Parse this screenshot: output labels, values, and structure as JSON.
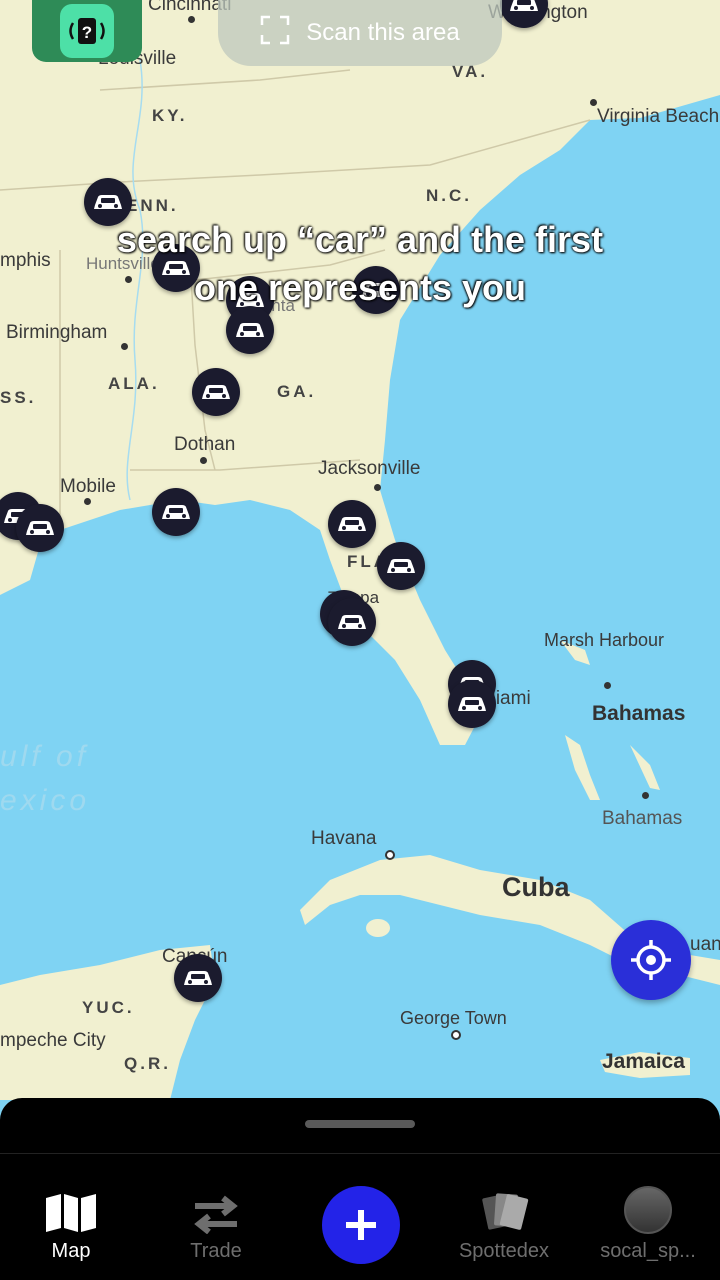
{
  "top": {
    "scan_label": "Scan this area",
    "badge_icon": "mystery-card-icon"
  },
  "caption": {
    "line1": "search up “car” and the first",
    "line2": "one represents you"
  },
  "map": {
    "cities": {
      "cincinnati": "Cincinnati",
      "louisville": "Louisville",
      "washington": "Washington",
      "virginia_beach": "Virginia Beach",
      "memphis": "mphis",
      "huntsville": "Huntsville",
      "birmingham": "Birmingham",
      "atlanta": "Atlanta",
      "dothan": "Dothan",
      "jacksonville": "Jacksonville",
      "mobile": "Mobile",
      "tampa": "Tampa",
      "miami": "Miami",
      "marsh_harbour": "Marsh Harbour",
      "havana": "Havana",
      "cancun": "Cancún",
      "george_town": "George Town",
      "campeche": "mpeche City",
      "juan": "uan"
    },
    "states": {
      "ky": "KY.",
      "va": "VA.",
      "tenn": "ENN.",
      "nc": "N.C.",
      "ala": "ALA.",
      "ga": "GA.",
      "miss": "SS.",
      "fla": "FLA.",
      "yuc": "YUC.",
      "qr": "Q.R."
    },
    "countries": {
      "bahamas": "Bahamas",
      "bahamas_small": "Bahamas",
      "cuba": "Cuba",
      "jamaica": "Jamaica"
    },
    "sea": {
      "gulf_line1": "ulf of",
      "gulf_line2": "exico"
    }
  },
  "colors": {
    "water": "#7fd3f3",
    "land": "#f1f0d0",
    "marker": "#1b1b2e",
    "accent": "#2a2fd8"
  },
  "nav": {
    "tabs": [
      {
        "label": "Map",
        "icon": "map-icon",
        "active": true
      },
      {
        "label": "Trade",
        "icon": "swap-arrows-icon",
        "active": false
      },
      {
        "label": "",
        "icon": "plus-icon",
        "active": false
      },
      {
        "label": "Spottedex",
        "icon": "cards-icon",
        "active": false
      },
      {
        "label": "socal_sp...",
        "icon": "avatar",
        "active": false
      }
    ]
  }
}
